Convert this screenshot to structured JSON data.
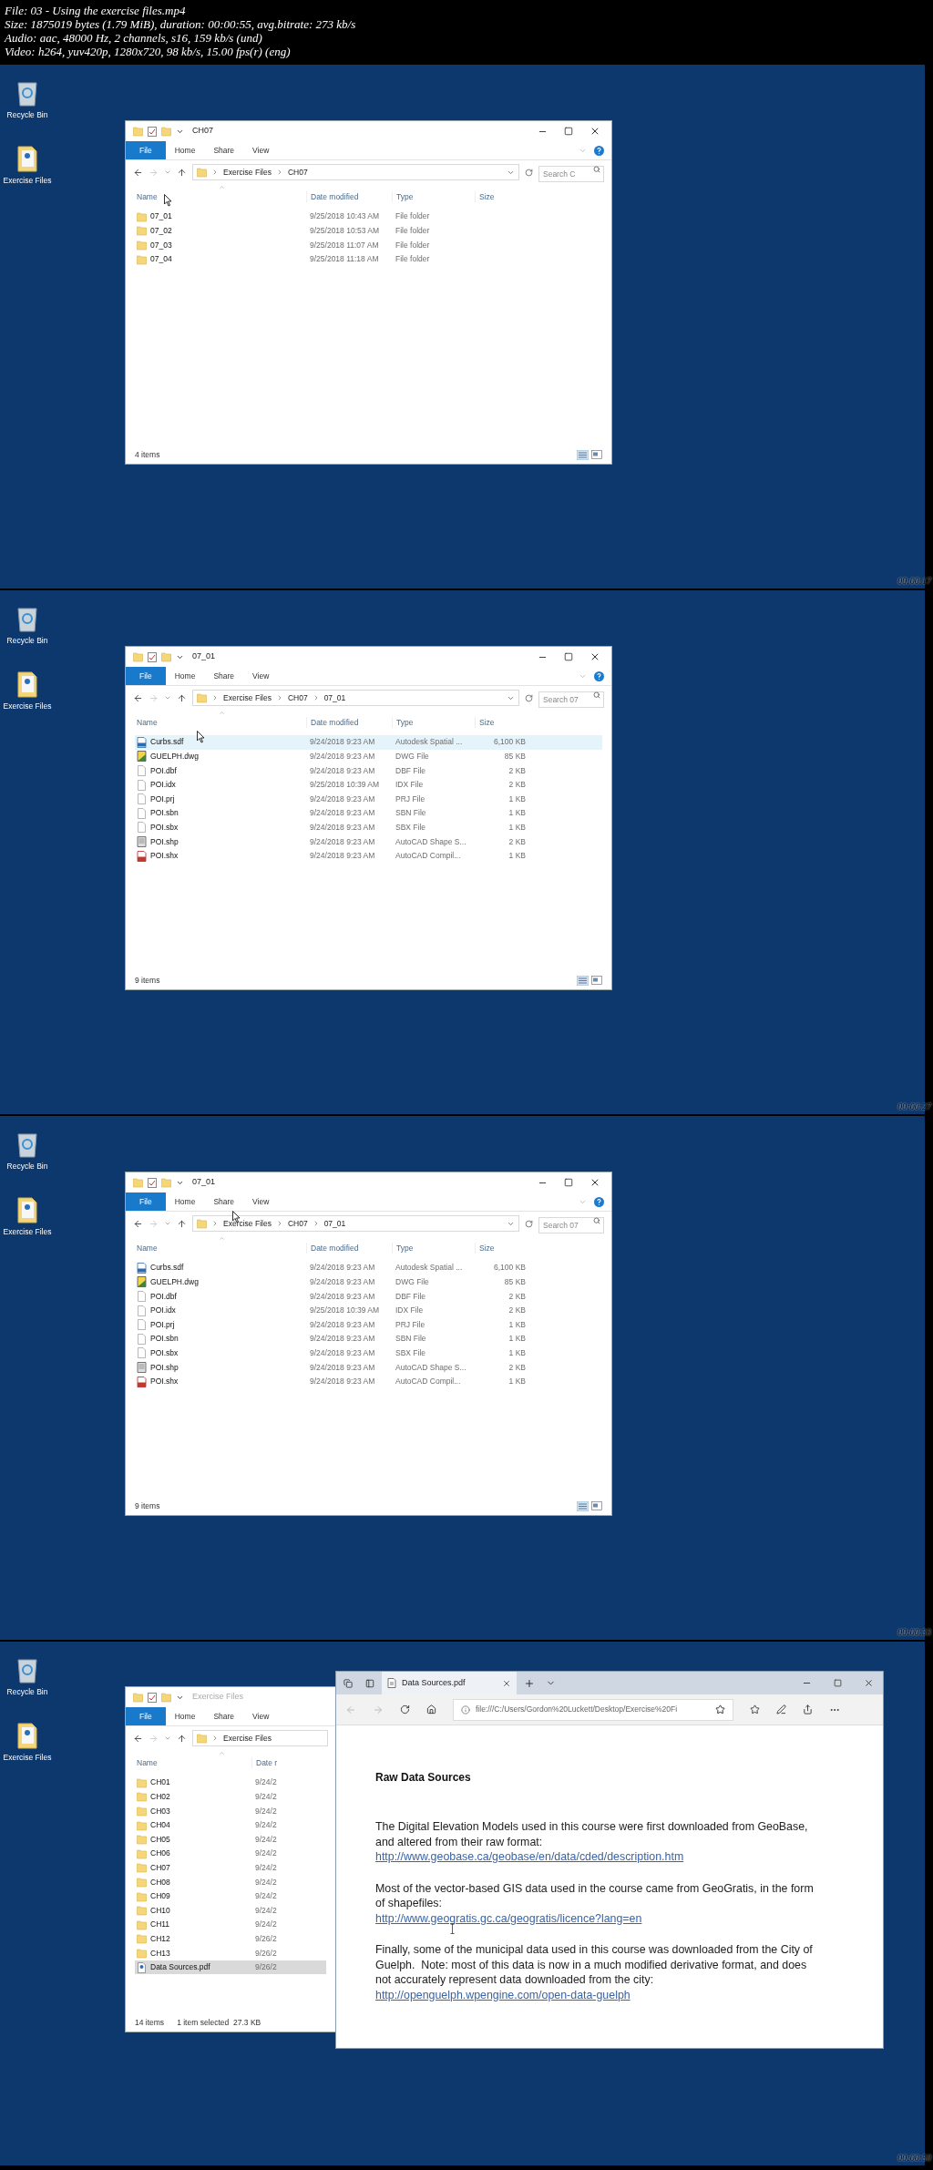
{
  "header": {
    "lines": [
      "File: 03 - Using the exercise files.mp4",
      "Size: 1875019 bytes (1.79 MiB), duration: 00:00:55, avg.bitrate: 273 kb/s",
      "Audio: aac, 48000 Hz, 2 channels, s16, 159 kb/s (und)",
      "Video: h264, yuv420p, 1280x720, 98 kb/s, 15.00 fps(r) (eng)"
    ]
  },
  "frames": [
    {
      "timestamp": "00:00:17",
      "cursor": {
        "kind": "arrow"
      },
      "desktop_icons": [
        {
          "label": "Recycle Bin",
          "kind": "recycle"
        },
        {
          "label": "Exercise Files",
          "kind": "pdf"
        }
      ],
      "explorer": {
        "title": "CH07",
        "active": true,
        "clipped": false,
        "ribbon_tabs": [
          {
            "label": "File",
            "kind": "file"
          },
          {
            "label": "Home",
            "kind": "tab"
          },
          {
            "label": "Share",
            "kind": "tab"
          },
          {
            "label": "View",
            "kind": "tab"
          }
        ],
        "breadcrumb": [
          "Exercise Files",
          "CH07"
        ],
        "search": {
          "placeholder": "Search C"
        },
        "columns": [
          "Name",
          "Date modified",
          "Type",
          "Size"
        ],
        "rows": [
          {
            "kind": "folder",
            "name": "07_01",
            "date": "9/25/2018 10:43 AM",
            "type": "File folder",
            "size": "",
            "hovered": false,
            "selected": false
          },
          {
            "kind": "folder",
            "name": "07_02",
            "date": "9/25/2018 10:53 AM",
            "type": "File folder",
            "size": "",
            "hovered": false,
            "selected": false
          },
          {
            "kind": "folder",
            "name": "07_03",
            "date": "9/25/2018 11:07 AM",
            "type": "File folder",
            "size": "",
            "hovered": false,
            "selected": false
          },
          {
            "kind": "folder",
            "name": "07_04",
            "date": "9/25/2018 11:18 AM",
            "type": "File folder",
            "size": "",
            "hovered": false,
            "selected": false
          }
        ],
        "status": {
          "items": "4 items"
        }
      }
    },
    {
      "timestamp": "00:00:27",
      "cursor": {
        "kind": "arrow"
      },
      "desktop_icons": [
        {
          "label": "Recycle Bin",
          "kind": "recycle"
        },
        {
          "label": "Exercise Files",
          "kind": "pdf"
        }
      ],
      "explorer": {
        "title": "07_01",
        "active": true,
        "clipped": false,
        "ribbon_tabs": [
          {
            "label": "File",
            "kind": "file"
          },
          {
            "label": "Home",
            "kind": "tab"
          },
          {
            "label": "Share",
            "kind": "tab"
          },
          {
            "label": "View",
            "kind": "tab"
          }
        ],
        "breadcrumb": [
          "Exercise Files",
          "CH07",
          "07_01"
        ],
        "search": {
          "placeholder": "Search 07"
        },
        "columns": [
          "Name",
          "Date modified",
          "Type",
          "Size"
        ],
        "rows": [
          {
            "kind": "sdf",
            "name": "Curbs.sdf",
            "date": "9/24/2018 9:23 AM",
            "type": "Autodesk Spatial ...",
            "size": "6,100 KB",
            "hovered": true,
            "selected": false
          },
          {
            "kind": "dwg",
            "name": "GUELPH.dwg",
            "date": "9/24/2018 9:23 AM",
            "type": "DWG File",
            "size": "85 KB",
            "hovered": false,
            "selected": false
          },
          {
            "kind": "file",
            "name": "POI.dbf",
            "date": "9/24/2018 9:23 AM",
            "type": "DBF File",
            "size": "2 KB",
            "hovered": false,
            "selected": false
          },
          {
            "kind": "file",
            "name": "POI.idx",
            "date": "9/25/2018 10:39 AM",
            "type": "IDX File",
            "size": "2 KB",
            "hovered": false,
            "selected": false
          },
          {
            "kind": "file",
            "name": "POI.prj",
            "date": "9/24/2018 9:23 AM",
            "type": "PRJ File",
            "size": "1 KB",
            "hovered": false,
            "selected": false
          },
          {
            "kind": "file",
            "name": "POI.sbn",
            "date": "9/24/2018 9:23 AM",
            "type": "SBN File",
            "size": "1 KB",
            "hovered": false,
            "selected": false
          },
          {
            "kind": "file",
            "name": "POI.sbx",
            "date": "9/24/2018 9:23 AM",
            "type": "SBX File",
            "size": "1 KB",
            "hovered": false,
            "selected": false
          },
          {
            "kind": "shp",
            "name": "POI.shp",
            "date": "9/24/2018 9:23 AM",
            "type": "AutoCAD Shape S...",
            "size": "2 KB",
            "hovered": false,
            "selected": false
          },
          {
            "kind": "shx",
            "name": "POI.shx",
            "date": "9/24/2018 9:23 AM",
            "type": "AutoCAD Compil...",
            "size": "1 KB",
            "hovered": false,
            "selected": false
          }
        ],
        "status": {
          "items": "9 items"
        }
      }
    },
    {
      "timestamp": "00:00:33",
      "cursor": {
        "kind": "arrow"
      },
      "desktop_icons": [
        {
          "label": "Recycle Bin",
          "kind": "recycle"
        },
        {
          "label": "Exercise Files",
          "kind": "pdf"
        }
      ],
      "explorer": {
        "title": "07_01",
        "active": true,
        "clipped": false,
        "ribbon_tabs": [
          {
            "label": "File",
            "kind": "file"
          },
          {
            "label": "Home",
            "kind": "tab"
          },
          {
            "label": "Share",
            "kind": "tab"
          },
          {
            "label": "View",
            "kind": "tab"
          }
        ],
        "breadcrumb": [
          "Exercise Files",
          "CH07",
          "07_01"
        ],
        "search": {
          "placeholder": "Search 07"
        },
        "columns": [
          "Name",
          "Date modified",
          "Type",
          "Size"
        ],
        "rows": [
          {
            "kind": "sdf",
            "name": "Curbs.sdf",
            "date": "9/24/2018 9:23 AM",
            "type": "Autodesk Spatial ...",
            "size": "6,100 KB",
            "hovered": false,
            "selected": false
          },
          {
            "kind": "dwg",
            "name": "GUELPH.dwg",
            "date": "9/24/2018 9:23 AM",
            "type": "DWG File",
            "size": "85 KB",
            "hovered": false,
            "selected": false
          },
          {
            "kind": "file",
            "name": "POI.dbf",
            "date": "9/24/2018 9:23 AM",
            "type": "DBF File",
            "size": "2 KB",
            "hovered": false,
            "selected": false
          },
          {
            "kind": "file",
            "name": "POI.idx",
            "date": "9/25/2018 10:39 AM",
            "type": "IDX File",
            "size": "2 KB",
            "hovered": false,
            "selected": false
          },
          {
            "kind": "file",
            "name": "POI.prj",
            "date": "9/24/2018 9:23 AM",
            "type": "PRJ File",
            "size": "1 KB",
            "hovered": false,
            "selected": false
          },
          {
            "kind": "file",
            "name": "POI.sbn",
            "date": "9/24/2018 9:23 AM",
            "type": "SBN File",
            "size": "1 KB",
            "hovered": false,
            "selected": false
          },
          {
            "kind": "file",
            "name": "POI.sbx",
            "date": "9/24/2018 9:23 AM",
            "type": "SBX File",
            "size": "1 KB",
            "hovered": false,
            "selected": false
          },
          {
            "kind": "shp",
            "name": "POI.shp",
            "date": "9/24/2018 9:23 AM",
            "type": "AutoCAD Shape S...",
            "size": "2 KB",
            "hovered": false,
            "selected": false
          },
          {
            "kind": "shx",
            "name": "POI.shx",
            "date": "9/24/2018 9:23 AM",
            "type": "AutoCAD Compil...",
            "size": "1 KB",
            "hovered": false,
            "selected": false
          }
        ],
        "status": {
          "items": "9 items"
        }
      }
    },
    {
      "timestamp": "00:00:50",
      "cursor": {
        "kind": "ibeam"
      },
      "desktop_icons": [
        {
          "label": "Recycle Bin",
          "kind": "recycle"
        },
        {
          "label": "Exercise Files",
          "kind": "pdf"
        }
      ],
      "explorer": {
        "title": "Exercise Files",
        "active": false,
        "clipped": true,
        "ribbon_tabs": [
          {
            "label": "File",
            "kind": "file"
          },
          {
            "label": "Home",
            "kind": "tab"
          },
          {
            "label": "Share",
            "kind": "tab"
          },
          {
            "label": "View",
            "kind": "tab"
          }
        ],
        "breadcrumb": [
          "Exercise Files"
        ],
        "columns": [
          "Name",
          "Date r"
        ],
        "rows": [
          {
            "kind": "folder",
            "name": "CH01",
            "date": "9/24/2",
            "hovered": false,
            "selected": false
          },
          {
            "kind": "folder",
            "name": "CH02",
            "date": "9/24/2",
            "hovered": false,
            "selected": false
          },
          {
            "kind": "folder",
            "name": "CH03",
            "date": "9/24/2",
            "hovered": false,
            "selected": false
          },
          {
            "kind": "folder",
            "name": "CH04",
            "date": "9/24/2",
            "hovered": false,
            "selected": false
          },
          {
            "kind": "folder",
            "name": "CH05",
            "date": "9/24/2",
            "hovered": false,
            "selected": false
          },
          {
            "kind": "folder",
            "name": "CH06",
            "date": "9/24/2",
            "hovered": false,
            "selected": false
          },
          {
            "kind": "folder",
            "name": "CH07",
            "date": "9/24/2",
            "hovered": false,
            "selected": false
          },
          {
            "kind": "folder",
            "name": "CH08",
            "date": "9/24/2",
            "hovered": false,
            "selected": false
          },
          {
            "kind": "folder",
            "name": "CH09",
            "date": "9/24/2",
            "hovered": false,
            "selected": false
          },
          {
            "kind": "folder",
            "name": "CH10",
            "date": "9/24/2",
            "hovered": false,
            "selected": false
          },
          {
            "kind": "folder",
            "name": "CH11",
            "date": "9/24/2",
            "hovered": false,
            "selected": false
          },
          {
            "kind": "folder",
            "name": "CH12",
            "date": "9/26/2",
            "hovered": false,
            "selected": false
          },
          {
            "kind": "folder",
            "name": "CH13",
            "date": "9/26/2",
            "hovered": false,
            "selected": false
          },
          {
            "kind": "pdf",
            "name": "Data Sources.pdf",
            "date": "9/26/2",
            "hovered": false,
            "selected": true
          }
        ],
        "status": {
          "items": "14 items",
          "selection": "1 item selected  27.3 KB"
        }
      },
      "browser": {
        "tab_title": "Data Sources.pdf",
        "address": "file:///C:/Users/Gordon%20Luckett/Desktop/Exercise%20Fi",
        "heading": "Raw Data Sources",
        "sections": [
          {
            "lines": [
              "The Digital Elevation Models used in this course were first downloaded from GeoBase,",
              "and altered from their raw format:"
            ],
            "link": "http://www.geobase.ca/geobase/en/data/cded/description.htm"
          },
          {
            "lines": [
              "Most of the vector-based GIS data used in the course came from GeoGratis, in the form",
              "of shapefiles:"
            ],
            "link": "http://www.geogratis.gc.ca/geogratis/licence?lang=en"
          },
          {
            "lines": [
              "Finally, some of the municipal data used in this course was downloaded from the City of",
              "Guelph.  Note: most of this data is now in a much modified derivative format, and does",
              "not accurately represent data downloaded from the city:"
            ],
            "link": "http://openguelph.wpengine.com/open-data-guelph"
          }
        ]
      }
    }
  ]
}
